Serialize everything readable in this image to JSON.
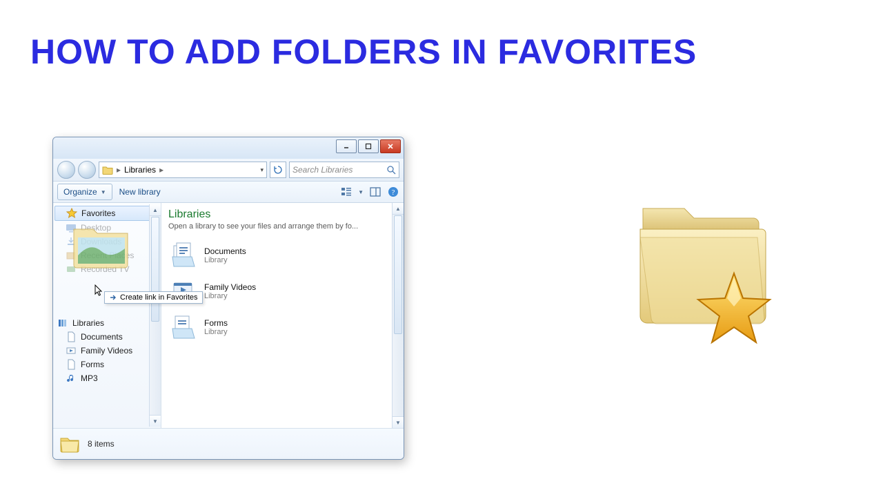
{
  "page": {
    "title": "HOW TO ADD FOLDERS IN FAVORITES"
  },
  "window": {
    "controls": {
      "min": "Minimize",
      "max": "Maximize",
      "close": "Close"
    },
    "address": {
      "root_icon": "folder-icon",
      "segments": [
        "Libraries"
      ],
      "search_placeholder": "Search Libraries"
    },
    "toolbar": {
      "organize_label": "Organize",
      "new_library_label": "New library"
    },
    "nav": {
      "favorites_label": "Favorites",
      "favorites_items": [
        "Desktop",
        "Downloads",
        "Recent Places",
        "Recorded TV"
      ],
      "libraries_label": "Libraries",
      "libraries_items": [
        "Documents",
        "Family Videos",
        "Forms",
        "MP3"
      ]
    },
    "drag_tooltip": "Create link in Favorites",
    "content": {
      "heading": "Libraries",
      "subheading": "Open a library to see your files and arrange them by fo...",
      "items": [
        {
          "name": "Documents",
          "type": "Library",
          "icon": "documents"
        },
        {
          "name": "Family Videos",
          "type": "Library",
          "icon": "videos"
        },
        {
          "name": "Forms",
          "type": "Library",
          "icon": "forms"
        }
      ]
    },
    "status": {
      "text": "8 items"
    }
  }
}
